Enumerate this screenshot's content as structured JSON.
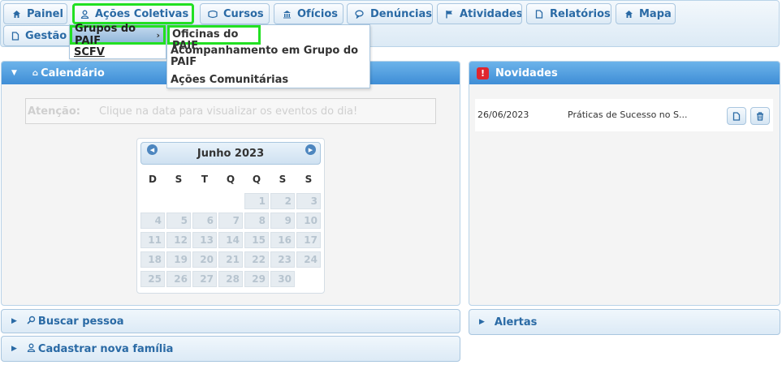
{
  "nav": {
    "painel": "Painel",
    "acoes_coletivas": "Ações Coletivas",
    "cursos": "Cursos",
    "oficios": "Ofícios",
    "denuncias": "Denúncias",
    "atividades": "Atividades",
    "relatorios": "Relatórios",
    "mapa": "Mapa",
    "gestao": "Gestão D"
  },
  "menu_level1": {
    "grupos_paif": "Grupos do PAIF",
    "scfv": "SCFV"
  },
  "menu_level2": {
    "oficinas": "Oficinas do PAIF",
    "acompanhamento_line1": "Acompanhamento em Grupo do",
    "acompanhamento_line2": "PAIF",
    "acoes_comunitarias": "Ações Comunitárias"
  },
  "calendar_panel": {
    "title": "Calendário",
    "attention_label": "Atenção:",
    "attention_msg": "Clique na data para visualizar os eventos do dia!",
    "month": "Junho 2023",
    "weekdays": [
      "D",
      "S",
      "T",
      "Q",
      "Q",
      "S",
      "S"
    ],
    "days": [
      "1",
      "2",
      "3",
      "4",
      "5",
      "6",
      "7",
      "8",
      "9",
      "10",
      "11",
      "12",
      "13",
      "14",
      "15",
      "16",
      "17",
      "18",
      "19",
      "20",
      "21",
      "22",
      "23",
      "24",
      "25",
      "26",
      "27",
      "28",
      "29",
      "30"
    ]
  },
  "news_panel": {
    "title": "Novidades",
    "item_date": "26/06/2023",
    "item_title": "Práticas de Sucesso no S..."
  },
  "panels": {
    "buscar": "Buscar pessoa",
    "cadastrar": "Cadastrar nova família",
    "alertas": "Alertas"
  },
  "colors": {
    "header_blue": "#3f8ed6",
    "highlight_green": "#22e022",
    "link_blue": "#2a6aa5"
  }
}
